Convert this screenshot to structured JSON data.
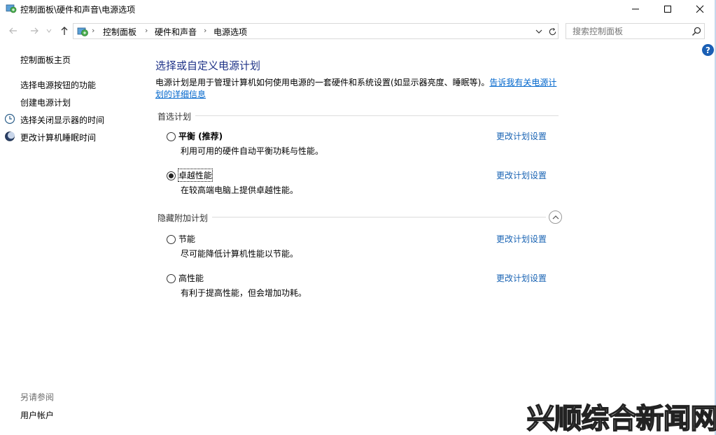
{
  "window": {
    "title": "控制面板\\硬件和声音\\电源选项"
  },
  "navigation": {
    "breadcrumbs": [
      "控制面板",
      "硬件和声音",
      "电源选项"
    ],
    "search_placeholder": "搜索控制面板"
  },
  "help": {
    "label": "?"
  },
  "sidebar": {
    "home": "控制面板主页",
    "links": [
      "选择电源按钮的功能",
      "创建电源计划",
      "选择关闭显示器的时间",
      "更改计算机睡眠时间"
    ],
    "see_also_header": "另请参阅",
    "see_also_links": [
      "用户帐户"
    ]
  },
  "main": {
    "title": "选择或自定义电源计划",
    "description": "电源计划是用于管理计算机如何使用电源的一套硬件和系统设置(如显示器亮度、睡眠等)。",
    "description_link": "告诉我有关电源计划的详细信息",
    "preferred_header": "首选计划",
    "hidden_header": "隐藏附加计划",
    "preferred_plans": [
      {
        "name": "平衡 (推荐)",
        "desc": "利用可用的硬件自动平衡功耗与性能。",
        "link": "更改计划设置",
        "selected": false
      },
      {
        "name": "卓越性能",
        "desc": "在较高端电脑上提供卓越性能。",
        "link": "更改计划设置",
        "selected": true
      }
    ],
    "hidden_plans": [
      {
        "name": "节能",
        "desc": "尽可能降低计算机性能以节能。",
        "link": "更改计划设置",
        "selected": false
      },
      {
        "name": "高性能",
        "desc": "有利于提高性能，但会增加功耗。",
        "link": "更改计划设置",
        "selected": false
      }
    ]
  },
  "watermark": "兴顺综合新闻网"
}
